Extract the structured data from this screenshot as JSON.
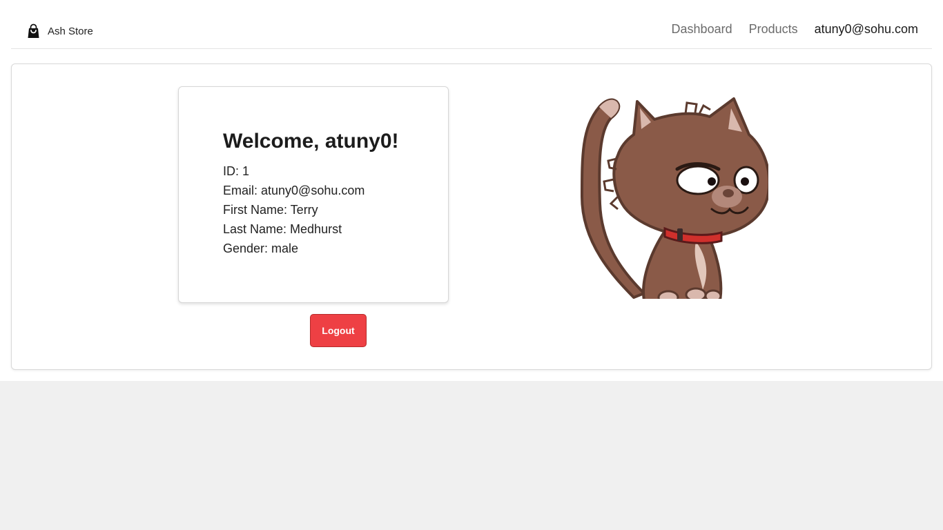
{
  "nav": {
    "brand_name": "Ash Store",
    "brand_icon": "shopping-bag-icon",
    "links": {
      "dashboard": "Dashboard",
      "products": "Products",
      "user_email": "atuny0@sohu.com"
    }
  },
  "profile": {
    "welcome": "Welcome, atuny0!",
    "id_line": "ID: 1",
    "email_line": "Email: atuny0@sohu.com",
    "first_name_line": "First Name: Terry",
    "last_name_line": "Last Name: Medhurst",
    "gender_line": "Gender: male"
  },
  "actions": {
    "logout_label": "Logout"
  },
  "colors": {
    "logout_bg": "#ee4044",
    "page_bg": "#f0f0f0",
    "cat_fur": "#8a5a48",
    "cat_collar": "#d0302c"
  }
}
